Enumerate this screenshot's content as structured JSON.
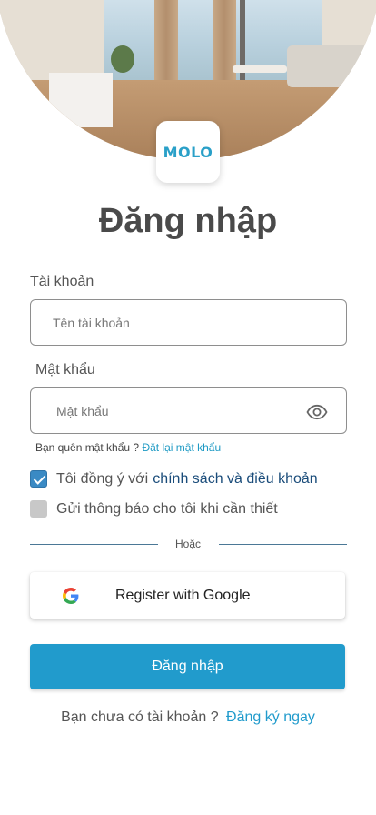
{
  "brand": {
    "logo_text": "MOLO",
    "accent": "#219bcc"
  },
  "title": "Đăng nhập",
  "account": {
    "label": "Tài khoản",
    "placeholder": "Tên tài khoản",
    "value": ""
  },
  "password": {
    "label": "Mật khẩu",
    "placeholder": "Mật khẩu",
    "value": "",
    "toggle_icon": "eye-icon"
  },
  "forgot": {
    "text": "Bạn quên mật khẩu ?",
    "link": "Đặt lại mật khẩu"
  },
  "agree": {
    "checked": true,
    "text": "Tôi đồng ý với",
    "link": "chính sách và điều khoản"
  },
  "notify": {
    "checked": false,
    "text": "Gửi thông báo cho tôi khi cần thiết"
  },
  "divider_text": "Hoặc",
  "google_button": {
    "label": "Register with Google",
    "icon": "google-icon"
  },
  "login_button": {
    "label": "Đăng nhập"
  },
  "signup": {
    "text": "Bạn chưa có tài khoản ?",
    "link": "Đăng ký ngay"
  }
}
